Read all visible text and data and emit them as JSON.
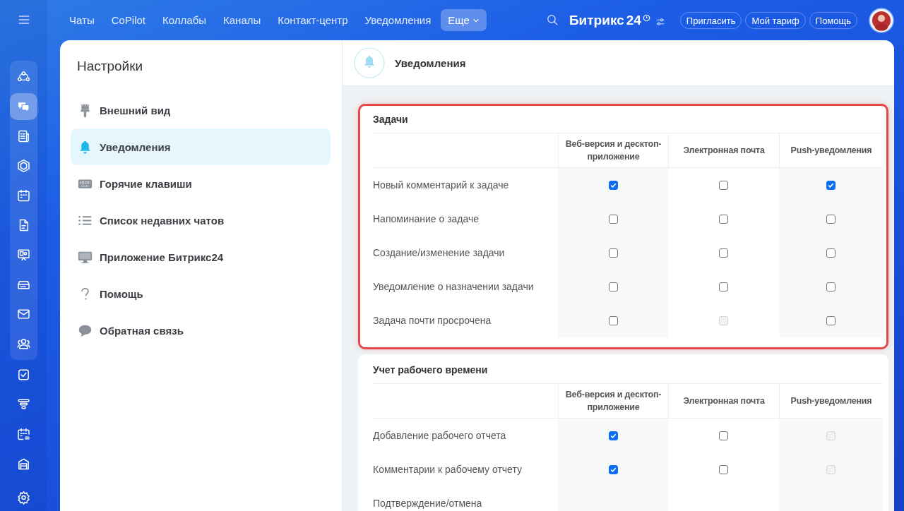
{
  "top_nav": {
    "items": [
      {
        "label": "Чаты",
        "selected": false
      },
      {
        "label": "CoPilot",
        "selected": false
      },
      {
        "label": "Коллабы",
        "selected": false
      },
      {
        "label": "Каналы",
        "selected": false
      },
      {
        "label": "Контакт-центр",
        "selected": false
      },
      {
        "label": "Уведомления",
        "selected": false
      },
      {
        "label": "Еще",
        "selected": true
      }
    ],
    "logo": "Битрикс",
    "logo_number": "24",
    "buttons": [
      "Пригласить",
      "Мой тариф",
      "Помощь"
    ]
  },
  "rail": {
    "pinned": [
      {
        "selected": false
      },
      {
        "selected": true
      },
      {
        "selected": false
      },
      {
        "selected": false
      },
      {
        "selected": false
      },
      {
        "selected": false
      },
      {
        "selected": false
      },
      {
        "selected": false
      },
      {
        "selected": false
      },
      {
        "selected": false
      }
    ],
    "more": [
      {
        "selected": false
      },
      {
        "selected": false
      },
      {
        "selected": false
      },
      {
        "selected": false
      }
    ]
  },
  "settings": {
    "title": "Настройки",
    "items": [
      {
        "label": "Внешний вид",
        "selected": false
      },
      {
        "label": "Уведомления",
        "selected": true
      },
      {
        "label": "Горячие клавиши",
        "selected": false
      },
      {
        "label": "Список недавних чатов",
        "selected": false
      },
      {
        "label": "Приложение Битрикс24",
        "selected": false
      },
      {
        "label": "Помощь",
        "selected": false
      },
      {
        "label": "Обратная связь",
        "selected": false
      }
    ]
  },
  "panel": {
    "title": "Уведомления",
    "sections": [
      {
        "title": "Задачи",
        "highlighted": true,
        "columns": [
          "Веб-версия и десктоп-приложение",
          "Электронная почта",
          "Push-уведомления"
        ],
        "rows": [
          {
            "label": "Новый комментарий к задаче",
            "cells": [
              {
                "checked": true,
                "disabled": false
              },
              {
                "checked": false,
                "disabled": false
              },
              {
                "checked": true,
                "disabled": false
              }
            ]
          },
          {
            "label": "Напоминание о задаче",
            "cells": [
              {
                "checked": false,
                "disabled": false
              },
              {
                "checked": false,
                "disabled": false
              },
              {
                "checked": false,
                "disabled": false
              }
            ]
          },
          {
            "label": "Создание/изменение задачи",
            "cells": [
              {
                "checked": false,
                "disabled": false
              },
              {
                "checked": false,
                "disabled": false
              },
              {
                "checked": false,
                "disabled": false
              }
            ]
          },
          {
            "label": "Уведомление о назначении задачи",
            "cells": [
              {
                "checked": false,
                "disabled": false
              },
              {
                "checked": false,
                "disabled": false
              },
              {
                "checked": false,
                "disabled": false
              }
            ]
          },
          {
            "label": "Задача почти просрочена",
            "cells": [
              {
                "checked": false,
                "disabled": false
              },
              {
                "checked": false,
                "disabled": true
              },
              {
                "checked": false,
                "disabled": false
              }
            ]
          }
        ]
      },
      {
        "title": "Учет рабочего времени",
        "highlighted": false,
        "columns": [
          "Веб-версия и десктоп-приложение",
          "Электронная почта",
          "Push-уведомления"
        ],
        "rows": [
          {
            "label": "Добавление рабочего отчета",
            "cells": [
              {
                "checked": true,
                "disabled": false
              },
              {
                "checked": false,
                "disabled": false
              },
              {
                "checked": false,
                "disabled": true
              }
            ]
          },
          {
            "label": "Комментарии к рабочему отчету",
            "cells": [
              {
                "checked": true,
                "disabled": false
              },
              {
                "checked": false,
                "disabled": false
              },
              {
                "checked": false,
                "disabled": true
              }
            ]
          },
          {
            "label": "Подтверждение/отмена"
          }
        ]
      }
    ]
  }
}
